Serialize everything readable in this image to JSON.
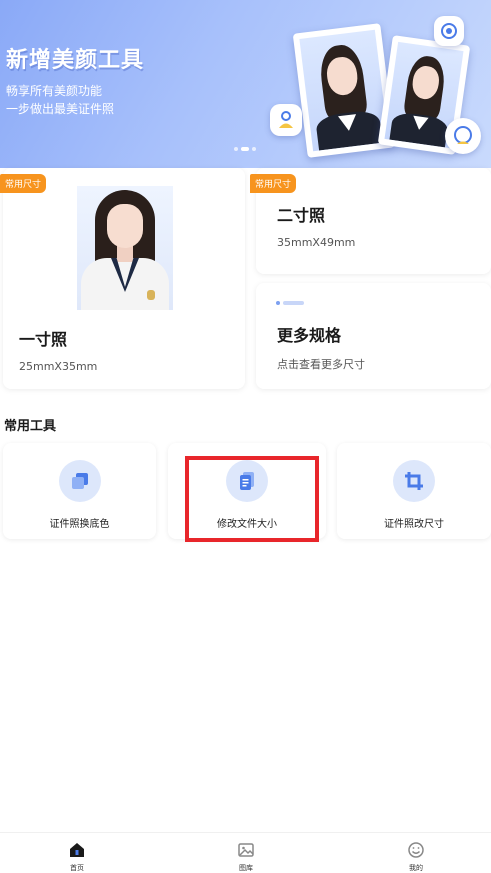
{
  "banner": {
    "title": "新增美颜工具",
    "line1": "畅享所有美颜功能",
    "line2": "一步做出最美证件照",
    "page_indicator": {
      "count": 4,
      "active": 2
    }
  },
  "sizes": [
    {
      "tag": "常用尺寸",
      "title": "一寸照",
      "subtitle": "25mmX35mm"
    },
    {
      "tag": "常用尺寸",
      "title": "二寸照",
      "subtitle": "35mmX49mm"
    },
    {
      "title": "更多规格",
      "subtitle": "点击查看更多尺寸"
    }
  ],
  "tools": {
    "section_title": "常用工具",
    "items": [
      {
        "label": "证件照换底色",
        "icon": "layers-icon"
      },
      {
        "label": "修改文件大小",
        "icon": "document-icon"
      },
      {
        "label": "证件照改尺寸",
        "icon": "crop-icon"
      }
    ]
  },
  "bottom_nav": [
    {
      "label": "首页",
      "icon": "home-icon",
      "active": true
    },
    {
      "label": "图库",
      "icon": "image-icon",
      "active": false
    },
    {
      "label": "我的",
      "icon": "smile-icon",
      "active": false
    }
  ],
  "colors": {
    "accent": "#4a7be8",
    "tag": "#f7941e",
    "highlight": "#e8262b",
    "icon_bg": "#dde7fb"
  }
}
